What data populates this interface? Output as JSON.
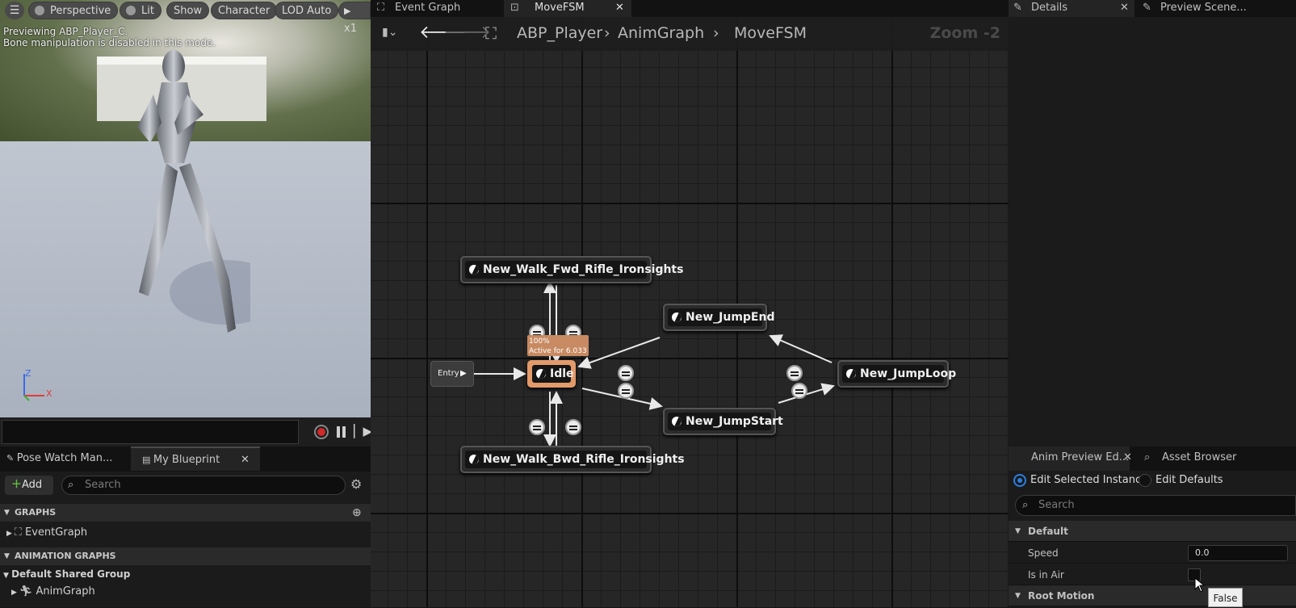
{
  "viewport": {
    "buttons": [
      "Perspective",
      "Lit",
      "Show",
      "Character",
      "LOD Auto",
      "x1"
    ],
    "info_line1": "Previewing ABP_Player_C.",
    "info_line2": "Bone manipulation is disabled in this mode.",
    "axis_z": "Z",
    "axis_x": "X"
  },
  "left_panel": {
    "tabs": [
      "Pose Watch Man...",
      "My Blueprint"
    ],
    "add_label": "Add",
    "search_placeholder": "Search",
    "sections": {
      "graphs": "GRAPHS",
      "animation_graphs": "ANIMATION GRAPHS"
    },
    "items": {
      "eventgraph": "EventGraph",
      "default_group": "Default Shared Group",
      "animgraph": "AnimGraph"
    }
  },
  "graph_tabs": [
    "Event Graph",
    "MoveFSM"
  ],
  "breadcrumb": [
    "ABP_Player",
    "AnimGraph",
    "MoveFSM"
  ],
  "zoom": "Zoom -2",
  "nodes": {
    "entry": "Entry",
    "idle": "Idle",
    "walk_fwd": "New_Walk_Fwd_Rifle_Ironsights",
    "walk_bwd": "New_Walk_Bwd_Rifle_Ironsights",
    "jump_end": "New_JumpEnd",
    "jump_start": "New_JumpStart",
    "jump_loop": "New_JumpLoop"
  },
  "idle_status": {
    "percent": "100%",
    "active": "Active for 6.033s"
  },
  "right_top_tabs": [
    "Details",
    "Preview Scene..."
  ],
  "anim_preview": {
    "tabs": [
      "Anim Preview Ed...",
      "Asset Browser"
    ],
    "radio_selected": "Edit Selected Instance",
    "radio_other": "Edit Defaults",
    "search_placeholder": "Search",
    "section_default": "Default",
    "speed_label": "Speed",
    "speed_value": "0.0",
    "is_in_air_label": "Is in Air",
    "section_root_motion": "Root Motion",
    "tooltip": "False"
  }
}
